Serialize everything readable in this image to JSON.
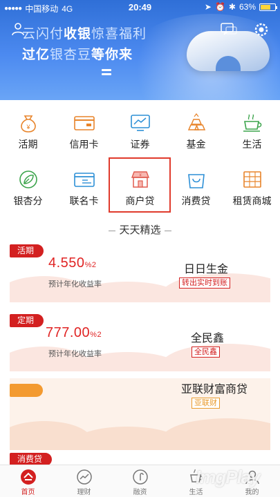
{
  "status": {
    "carrier": "中国移动",
    "network": "4G",
    "time": "20:49",
    "battery": "63%",
    "battery_level": 0.63
  },
  "banner": {
    "line1_a": "云闪付",
    "line1_b": "收银",
    "line1_c": "惊喜福利",
    "line2_a": "过亿",
    "line2_b": "银杏豆",
    "line2_c": "等你来"
  },
  "grid": [
    {
      "label": "活期",
      "icon": "money-bag-icon"
    },
    {
      "label": "信用卡",
      "icon": "credit-card-icon"
    },
    {
      "label": "证券",
      "icon": "monitor-chart-icon"
    },
    {
      "label": "基金",
      "icon": "gold-bars-icon"
    },
    {
      "label": "生活",
      "icon": "tea-cup-icon"
    },
    {
      "label": "银杏分",
      "icon": "ginkgo-leaf-icon"
    },
    {
      "label": "联名卡",
      "icon": "cobranded-card-icon"
    },
    {
      "label": "商户贷",
      "icon": "shop-icon"
    },
    {
      "label": "消费贷",
      "icon": "shopping-bag-icon"
    },
    {
      "label": "租赁商城",
      "icon": "rental-store-icon"
    }
  ],
  "featured": {
    "title": "天天精选",
    "items": [
      {
        "tag": "活期",
        "rate": "4.550",
        "rate_suffix": "%2",
        "rate_label": "预计年化收益率",
        "name": "日日生金",
        "badge": "转出实时到账"
      },
      {
        "tag": "定期",
        "rate": "777.00",
        "rate_suffix": "%2",
        "rate_label": "预计年化收益率",
        "name": "全民鑫",
        "badge": "全民鑫"
      },
      {
        "tag": "",
        "rate": "",
        "rate_suffix": "",
        "rate_label": "",
        "name": "亚联财富商贷",
        "badge": "亚联财"
      },
      {
        "tag": "消费贷"
      }
    ]
  },
  "tabs": [
    {
      "label": "首页",
      "icon": "home-icon"
    },
    {
      "label": "理财",
      "icon": "finance-chart-icon"
    },
    {
      "label": "融资",
      "icon": "loan-icon"
    },
    {
      "label": "生活",
      "icon": "life-cup-icon"
    },
    {
      "label": "我的",
      "icon": "profile-icon"
    }
  ],
  "watermark": "ImgPlay",
  "colors": {
    "brand_red": "#d32020",
    "banner_blue": "#3a7be3",
    "gold": "#e99a2c"
  }
}
